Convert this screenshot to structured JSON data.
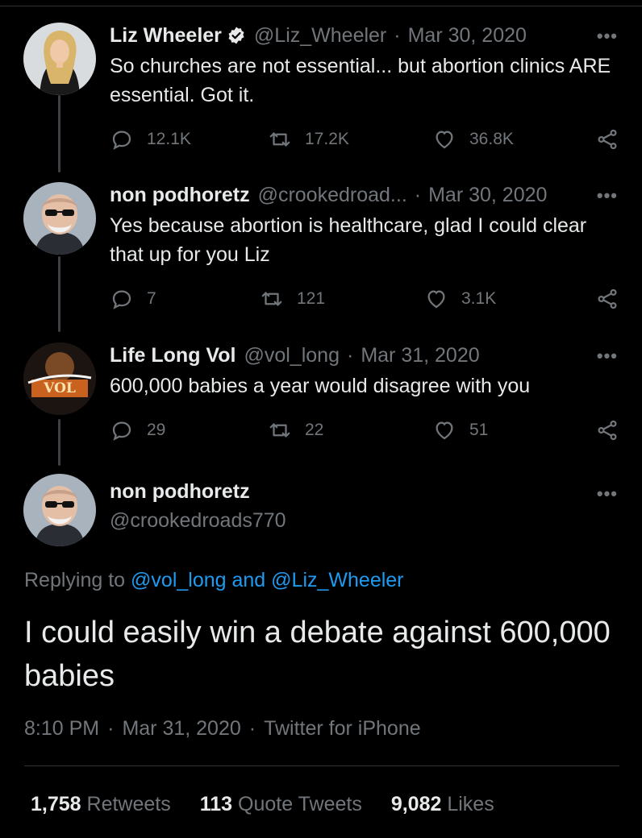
{
  "thread": [
    {
      "name": "Liz Wheeler",
      "verified": true,
      "handle": "@Liz_Wheeler",
      "date": "Mar 30, 2020",
      "text": "So churches are not essential... but abortion clinics ARE essential. Got it.",
      "replies": "12.1K",
      "retweets": "17.2K",
      "likes": "36.8K",
      "avatar_icon": "woman-portrait-avatar"
    },
    {
      "name": "non podhoretz",
      "verified": false,
      "handle": "@crookedroad...",
      "date": "Mar 30, 2020",
      "text": "Yes because abortion is healthcare, glad I could clear that up for you Liz",
      "replies": "7",
      "retweets": "121",
      "likes": "3.1K",
      "avatar_icon": "man-sunglasses-avatar"
    },
    {
      "name": "Life Long Vol",
      "verified": false,
      "handle": "@vol_long",
      "date": "Mar 31, 2020",
      "text": "600,000 babies a year would disagree with you",
      "replies": "29",
      "retweets": "22",
      "likes": "51",
      "avatar_icon": "let-them-vol-logo-avatar"
    }
  ],
  "main_tweet": {
    "name": "non podhoretz",
    "handle": "@crookedroads770",
    "replying_prefix": "Replying to",
    "replying_mention_1": "@vol_long",
    "replying_and": "and",
    "replying_mention_2": "@Liz_Wheeler",
    "text": "I could easily win a debate against 600,000 babies",
    "time": "8:10 PM",
    "date": "Mar 31, 2020",
    "source": "Twitter for iPhone",
    "stats": {
      "retweets_num": "1,758",
      "retweets_label": "Retweets",
      "quotes_num": "113",
      "quotes_label": "Quote Tweets",
      "likes_num": "9,082",
      "likes_label": "Likes"
    }
  },
  "ui": {
    "more_glyph": "•••",
    "separator": "·"
  },
  "colors": {
    "background": "#000000",
    "text": "#e7e9ea",
    "muted": "#71767b",
    "accent": "#1d9bf0"
  }
}
